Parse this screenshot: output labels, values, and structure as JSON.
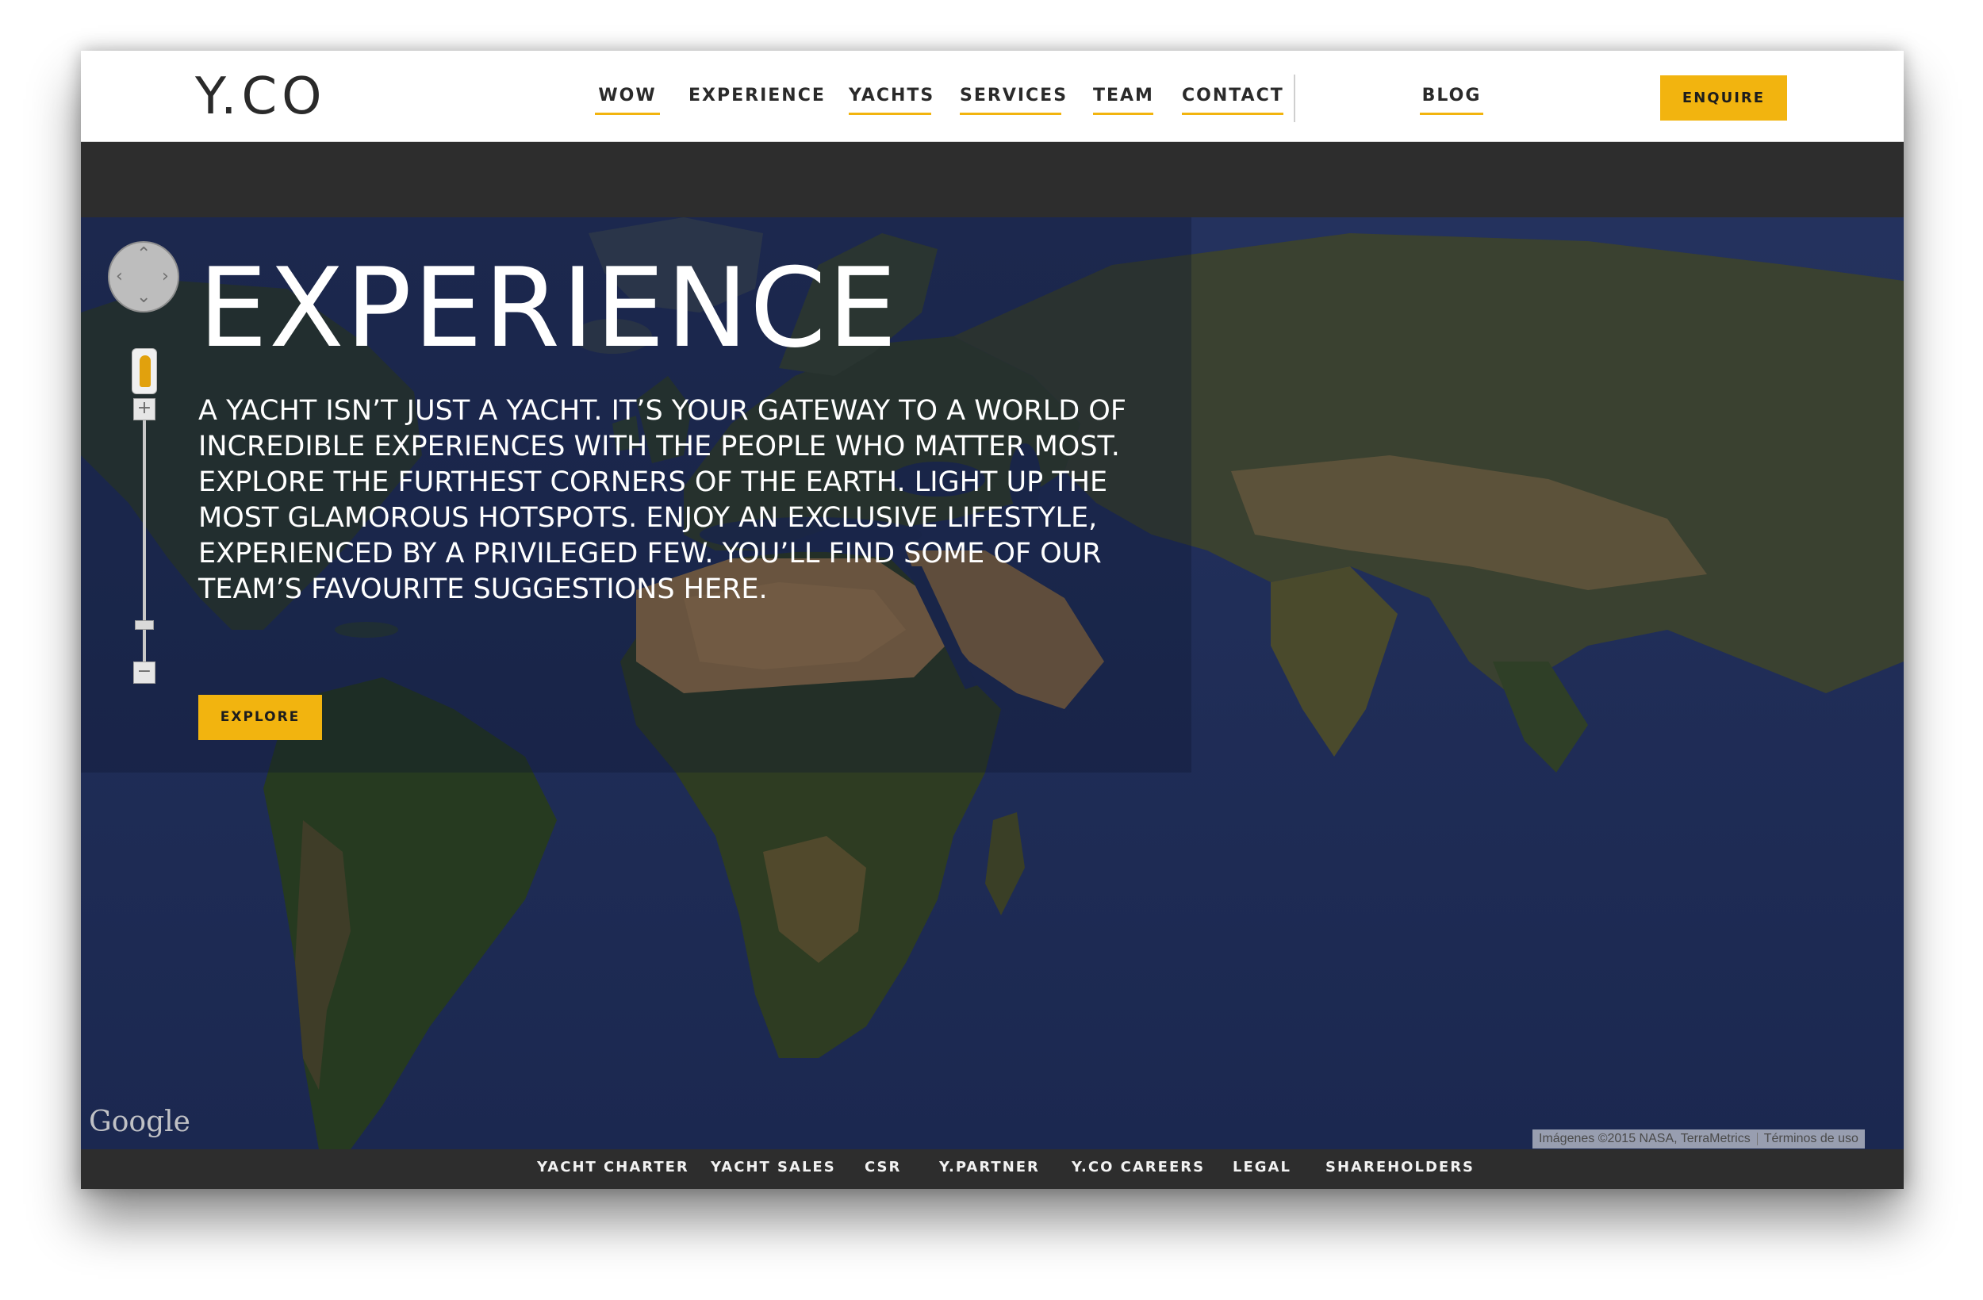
{
  "header": {
    "logo": "Y.CO",
    "nav": [
      {
        "label": "WOW",
        "underlined": true
      },
      {
        "label": "EXPERIENCE",
        "underlined": false
      },
      {
        "label": "YACHTS",
        "underlined": true
      },
      {
        "label": "SERVICES",
        "underlined": true
      },
      {
        "label": "TEAM",
        "underlined": true
      },
      {
        "label": "CONTACT",
        "underlined": true
      },
      {
        "label": "BLOG",
        "underlined": true
      }
    ],
    "enquire_label": "ENQUIRE"
  },
  "hero": {
    "title": "EXPERIENCE",
    "body": "A yacht isn’t just a yacht. It’s your gateway to a world of incredible experiences with the people who matter most. Explore the furthest corners of the Earth. Light up the most glamorous hotspots. Enjoy an exclusive lifestyle, experienced by a privileged few. You’ll find some of our team’s favourite suggestions here.",
    "explore_label": "EXPLORE"
  },
  "map": {
    "provider_logo": "Google",
    "attribution": "Imágenes ©2015 NASA, TerraMetrics",
    "terms": "Términos de uso",
    "zoom_in_symbol": "+",
    "zoom_out_symbol": "−"
  },
  "footer": {
    "links": [
      "YACHT CHARTER",
      "YACHT SALES",
      "CSR",
      "Y.PARTNER",
      "Y.CO CAREERS",
      "LEGAL",
      "SHAREHOLDERS"
    ]
  },
  "colors": {
    "accent": "#f2b40f",
    "ocean": "#1f2d55",
    "header_bg": "#ffffff",
    "footer_bg": "#2d2d2d"
  }
}
